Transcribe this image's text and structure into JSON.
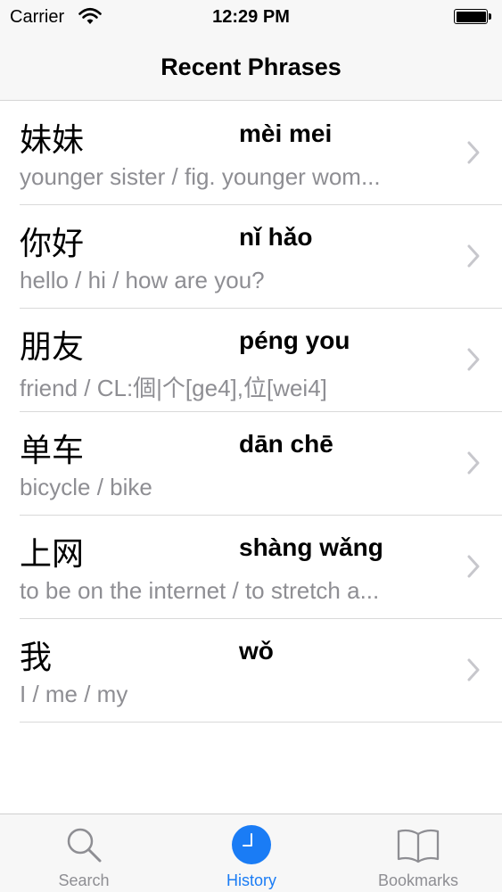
{
  "status_bar": {
    "carrier": "Carrier",
    "time": "12:29 PM"
  },
  "nav": {
    "title": "Recent Phrases"
  },
  "phrases": [
    {
      "hanzi": "妹妹",
      "pinyin": "mèi mei",
      "definition": "younger sister / fig. younger wom..."
    },
    {
      "hanzi": "你好",
      "pinyin": "nǐ hǎo",
      "definition": "hello / hi / how are you?"
    },
    {
      "hanzi": "朋友",
      "pinyin": "péng you",
      "definition": "friend / CL:個|个[ge4],位[wei4]"
    },
    {
      "hanzi": "单车",
      "pinyin": "dān chē",
      "definition": "bicycle / bike"
    },
    {
      "hanzi": "上网",
      "pinyin": "shàng wǎng",
      "definition": "to be on the internet / to stretch a..."
    },
    {
      "hanzi": "我",
      "pinyin": "wǒ",
      "definition": "I / me / my"
    }
  ],
  "tabs": [
    {
      "label": "Search",
      "icon": "search-icon"
    },
    {
      "label": "History",
      "icon": "clock-icon"
    },
    {
      "label": "Bookmarks",
      "icon": "book-icon"
    }
  ],
  "colors": {
    "accent": "#1a7cf5",
    "inactive": "#8e8e93",
    "secondary_text": "#8e8e93"
  }
}
